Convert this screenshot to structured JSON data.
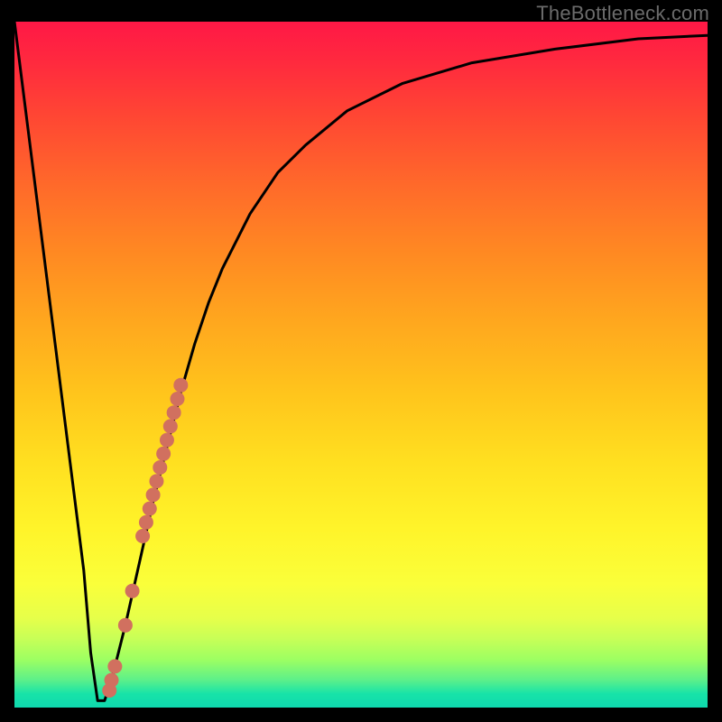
{
  "watermark": "TheBottleneck.com",
  "colors": {
    "curve_stroke": "#000000",
    "marker_fill": "#d1705f",
    "background_black": "#000000"
  },
  "chart_data": {
    "type": "line",
    "title": "",
    "xlabel": "",
    "ylabel": "",
    "xlim": [
      0,
      100
    ],
    "ylim": [
      0,
      100
    ],
    "series": [
      {
        "name": "bottleneck-curve",
        "x": [
          0,
          2,
          4,
          6,
          8,
          10,
          11,
          12,
          13,
          14,
          16,
          18,
          20,
          22,
          24,
          26,
          28,
          30,
          34,
          38,
          42,
          48,
          56,
          66,
          78,
          90,
          100
        ],
        "y": [
          100,
          84,
          68,
          52,
          36,
          20,
          8,
          1,
          1,
          4,
          12,
          21,
          30,
          38,
          46,
          53,
          59,
          64,
          72,
          78,
          82,
          87,
          91,
          94,
          96,
          97.5,
          98
        ]
      }
    ],
    "markers": [
      {
        "name": "dot-upper-1",
        "x": 24.0,
        "y": 47
      },
      {
        "name": "dot-upper-2",
        "x": 23.5,
        "y": 45
      },
      {
        "name": "dot-upper-3",
        "x": 23.0,
        "y": 43
      },
      {
        "name": "dot-upper-4",
        "x": 22.5,
        "y": 41
      },
      {
        "name": "dot-upper-5",
        "x": 22.0,
        "y": 39
      },
      {
        "name": "dot-upper-6",
        "x": 21.5,
        "y": 37
      },
      {
        "name": "dot-upper-7",
        "x": 21.0,
        "y": 35
      },
      {
        "name": "dot-upper-8",
        "x": 20.5,
        "y": 33
      },
      {
        "name": "dot-upper-9",
        "x": 20.0,
        "y": 31
      },
      {
        "name": "dot-upper-10",
        "x": 19.5,
        "y": 29
      },
      {
        "name": "dot-upper-11",
        "x": 19.0,
        "y": 27
      },
      {
        "name": "dot-upper-12",
        "x": 18.5,
        "y": 25
      },
      {
        "name": "dot-mid-1",
        "x": 17.0,
        "y": 17
      },
      {
        "name": "dot-mid-2",
        "x": 16.0,
        "y": 12
      },
      {
        "name": "dot-low-1",
        "x": 14.5,
        "y": 6
      },
      {
        "name": "dot-low-2",
        "x": 14.0,
        "y": 4
      },
      {
        "name": "dot-low-3",
        "x": 13.7,
        "y": 2.5
      }
    ]
  }
}
